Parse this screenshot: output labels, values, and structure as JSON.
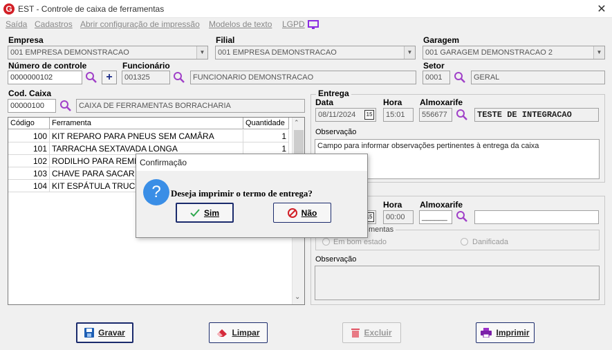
{
  "window": {
    "title": "EST - Controle de caixa de ferramentas",
    "app_icon_letter": "G",
    "close": "✕"
  },
  "menu": [
    "Saída",
    "Cadastros",
    "Abrir configuração de impressão",
    "Modelos de texto",
    "LGPD"
  ],
  "empresa": {
    "label": "Empresa",
    "value": "001 EMPRESA DEMONSTRACAO"
  },
  "filial": {
    "label": "Filial",
    "value": "001 EMPRESA DEMONSTRACAO"
  },
  "garagem": {
    "label": "Garagem",
    "value": "001 GARAGEM DEMONSTRACAO 2"
  },
  "numero_controle": {
    "label": "Número de controle",
    "value": "0000000102",
    "plus": "+"
  },
  "funcionario": {
    "label": "Funcionário",
    "code": "001325",
    "name": "FUNCIONARIO DEMONSTRACAO"
  },
  "setor": {
    "label": "Setor",
    "code": "0001",
    "name": "GERAL"
  },
  "cod_caixa": {
    "label": "Cod. Caixa",
    "code": "00000100",
    "name": "CAIXA DE FERRAMENTAS BORRACHARIA"
  },
  "grid": {
    "headers": [
      "Código",
      "Ferramenta",
      "Quantidade"
    ],
    "rows": [
      {
        "codigo": "100",
        "ferramenta": "KIT REPARO PARA PNEUS SEM CAMÂRA",
        "quantidade": "1"
      },
      {
        "codigo": "101",
        "ferramenta": "TARRACHA SEXTAVADA LONGA",
        "quantidade": "1"
      },
      {
        "codigo": "102",
        "ferramenta": "RODILHO PARA REMEN",
        "quantidade": ""
      },
      {
        "codigo": "103",
        "ferramenta": "CHAVE PARA SACAR VÁ",
        "quantidade": ""
      },
      {
        "codigo": "104",
        "ferramenta": "KIT ESPÁTULA TRUCK",
        "quantidade": ""
      }
    ]
  },
  "entrega": {
    "title": "Entrega",
    "data_label": "Data",
    "data": "08/11/2024",
    "cal": "15",
    "hora_label": "Hora",
    "hora": "15:01",
    "almox_label": "Almoxarife",
    "almox_code": "556677",
    "almox_name": "TESTE DE INTEGRACAO",
    "obs_label": "Observação",
    "obs": "Campo para informar observações pertinentes à entrega da caixa"
  },
  "devolucao": {
    "hora_label": "Hora",
    "hora": "00:00",
    "almox_label": "Almoxarife",
    "almox_code": "______",
    "cal": "15",
    "estado_title": "mentas",
    "radio_bom": "Em bom estado",
    "radio_danificada": "Danificada",
    "obs_label": "Observação"
  },
  "buttons": {
    "gravar": "Gravar",
    "limpar": "Limpar",
    "excluir": "Excluir",
    "imprimir": "Imprimir"
  },
  "dialog": {
    "title": "Confirmação",
    "message": "Deseja imprimir o termo de entrega?",
    "icon": "?",
    "sim": "Sim",
    "nao": "Não"
  },
  "colors": {
    "accent": "#1a2a6c",
    "brand": "#d21f26",
    "question": "#3a8ee6",
    "search": "#a040c8"
  }
}
